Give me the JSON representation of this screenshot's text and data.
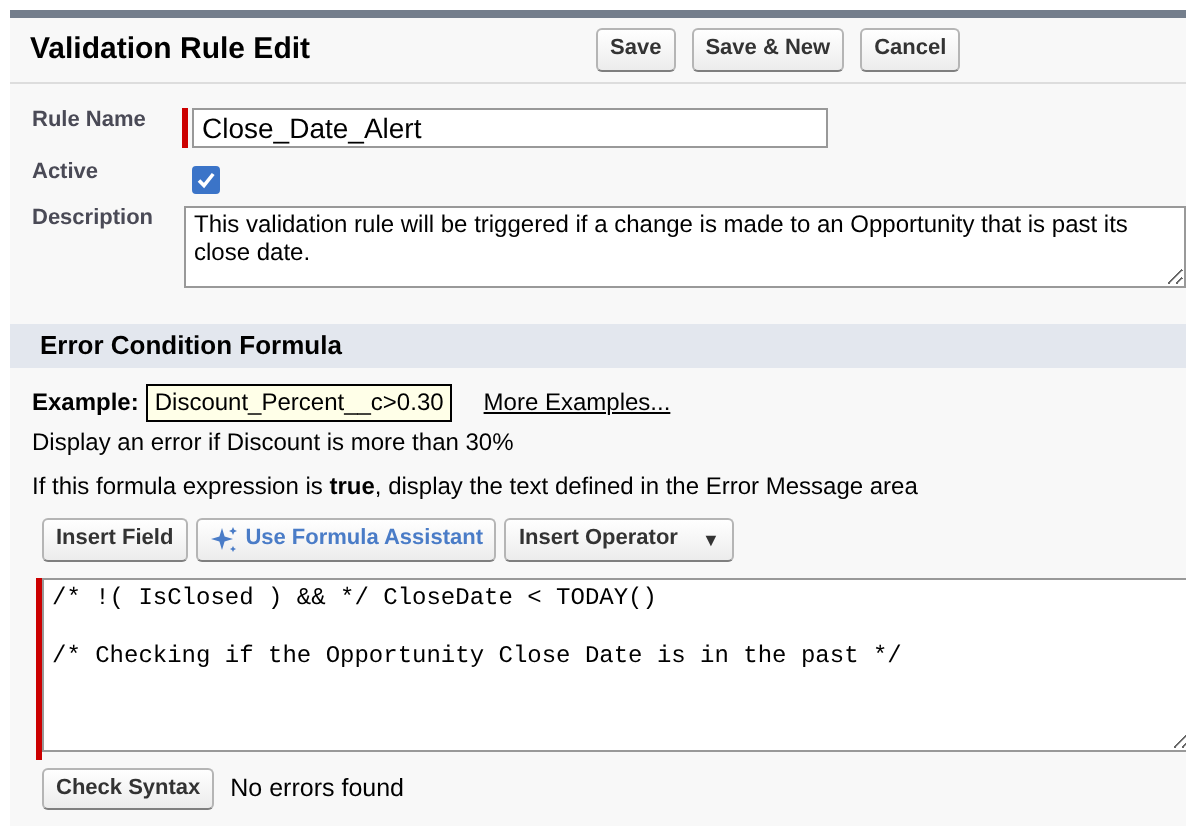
{
  "header": {
    "title": "Validation Rule Edit",
    "buttons": [
      "Save",
      "Save & New",
      "Cancel"
    ]
  },
  "fields": [
    {
      "kind": "text",
      "label": "Rule Name",
      "value": "Close_Date_Alert",
      "required": true
    },
    {
      "kind": "checkbox",
      "label": "Active",
      "checked": true
    },
    {
      "kind": "textarea",
      "label": "Description",
      "value": "This validation rule will be triggered if a change is made to an Opportunity that is past its close date."
    }
  ],
  "section": {
    "title": "Error Condition Formula",
    "example_label": "Example:",
    "example_value": "Discount_Percent__c>0.30",
    "more_link": "More Examples...",
    "help_lines": [
      "Display an error if Discount is more than 30%",
      "If this formula expression is **true**, display the text defined in the Error Message area"
    ],
    "toolbar": [
      {
        "kind": "plain",
        "label": "Insert Field"
      },
      {
        "kind": "assistant",
        "label": "Use Formula Assistant"
      },
      {
        "kind": "dropdown",
        "label": "Insert Operator",
        "caret": "▼"
      }
    ],
    "formula": "/* !( IsClosed ) && */ CloseDate < TODAY()\n\n/* Checking if the Opportunity Close Date is in the past */",
    "formula_required": true,
    "check_button": "Check Syntax",
    "check_result": "No errors found"
  }
}
